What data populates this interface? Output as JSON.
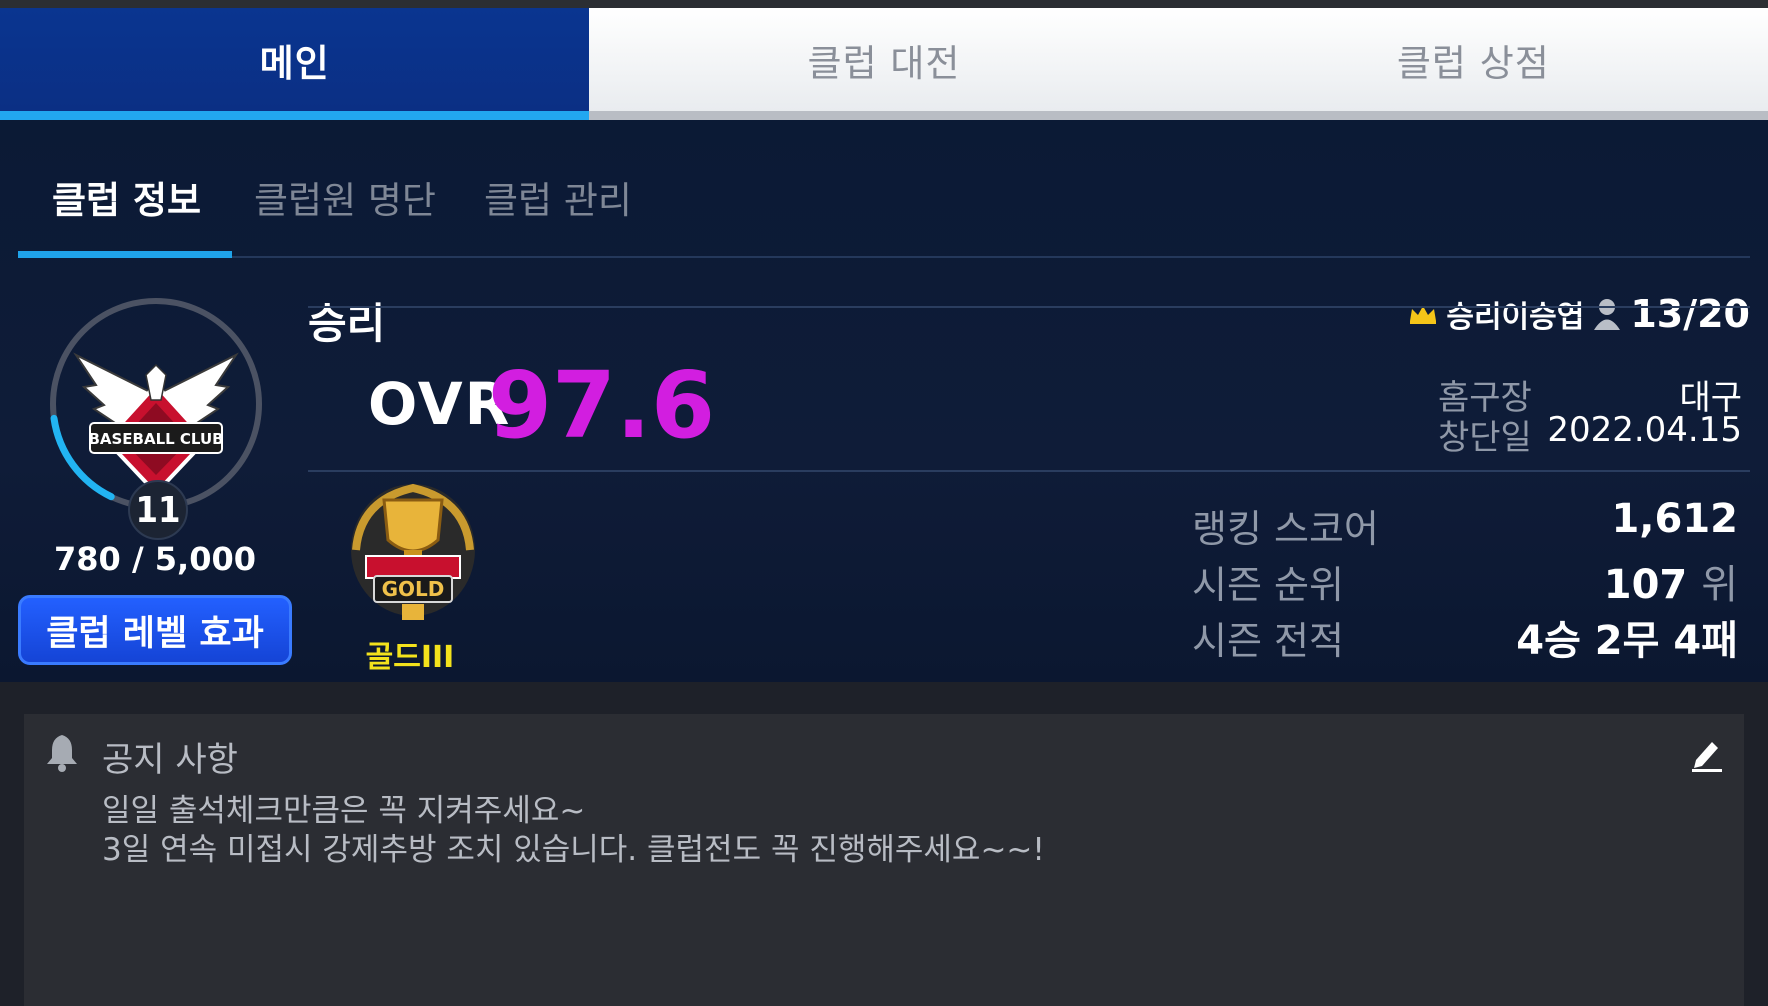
{
  "main_tabs": [
    {
      "label": "메인",
      "active": true
    },
    {
      "label": "클럽 대전",
      "active": false
    },
    {
      "label": "클럽 상점",
      "active": false
    }
  ],
  "sub_tabs": [
    {
      "label": "클럽 정보",
      "active": true
    },
    {
      "label": "클럽원 명단",
      "active": false
    },
    {
      "label": "클럽 관리",
      "active": false
    }
  ],
  "club": {
    "name": "승리",
    "owner": "승리이승엽",
    "members": "13/20",
    "emblem_text": "BASEBALL CLUB",
    "level": "11",
    "exp": "780 / 5,000",
    "exp_fraction": 0.156,
    "level_button": "클럽 레벨 효과",
    "ovr_label": "OVR",
    "ovr_value": "97.6",
    "home_label": "홈구장",
    "home_value": "대구",
    "founded_label": "창단일",
    "founded_value": "2022.04.15",
    "tier_badge_text": "GOLD",
    "tier_name": "골드III",
    "ranking_label": "랭킹 스코어",
    "ranking_value": "1,612",
    "season_rank_label": "시즌 순위",
    "season_rank_value": "107",
    "season_rank_unit": "위",
    "season_record_label": "시즌 전적",
    "season_record_value": "4승 2무 4패"
  },
  "notice": {
    "title": "공지 사항",
    "body": "일일 출석체크만큼은 꼭 지켜주세요~\n3일 연속 미접시 강제추방 조치 있습니다. 클럽전도 꼭 진행해주세요~~!"
  },
  "colors": {
    "accent_blue": "#1fa3ea",
    "active_tab": "#0b3289",
    "ovr": "#d21ee0",
    "tier": "#f3e21c",
    "notice_bg": "#2b2d33"
  },
  "icons": [
    "crown-icon",
    "member-icon",
    "bell-icon",
    "edit-icon",
    "club-emblem",
    "gold-trophy-icon"
  ]
}
